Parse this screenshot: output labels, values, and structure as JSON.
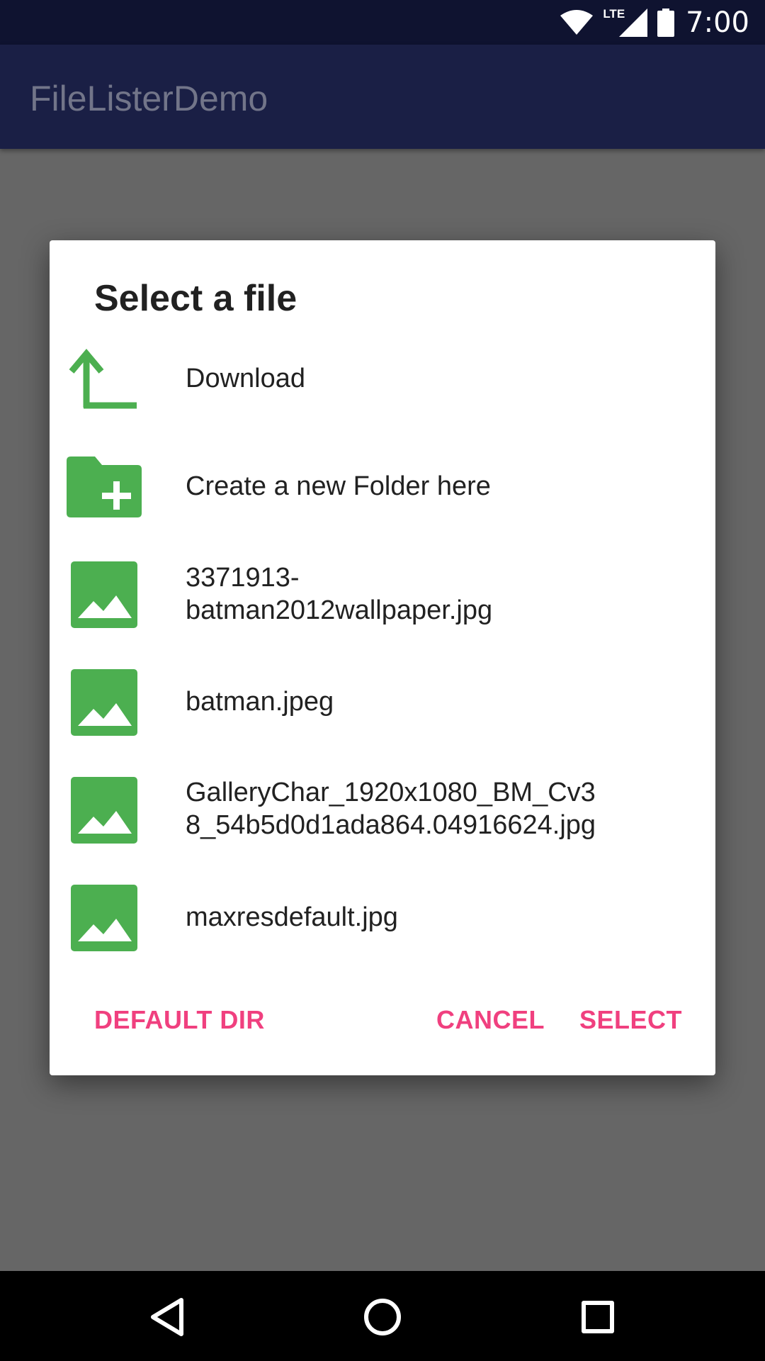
{
  "status_bar": {
    "time": "7:00",
    "network_label": "LTE",
    "icons": [
      "wifi-icon",
      "lte-signal-icon",
      "battery-icon"
    ]
  },
  "app_bar": {
    "title": "FileListerDemo"
  },
  "dialog": {
    "title": "Select a file",
    "items": [
      {
        "icon": "folder-up-icon",
        "label": "Download"
      },
      {
        "icon": "folder-add-icon",
        "label": "Create a new Folder here"
      },
      {
        "icon": "image-icon",
        "label": "3371913-\nbatman2012wallpaper.jpg"
      },
      {
        "icon": "image-icon",
        "label": "batman.jpeg"
      },
      {
        "icon": "image-icon",
        "label": "GalleryChar_1920x1080_BM_Cv38_54b5d0d1ada864.04916624.jpg"
      },
      {
        "icon": "image-icon",
        "label": "maxresdefault.jpg"
      }
    ],
    "actions": {
      "default_dir": "DEFAULT DIR",
      "cancel": "CANCEL",
      "select": "SELECT"
    }
  },
  "colors": {
    "status_bar": "#0f1330",
    "app_bar": "#1a1f45",
    "scrim": "#666666",
    "icon_green": "#4caf50",
    "accent_pink": "#f0407f"
  },
  "nav_bar": {
    "icons": [
      "back-icon",
      "home-icon",
      "recents-icon"
    ]
  }
}
